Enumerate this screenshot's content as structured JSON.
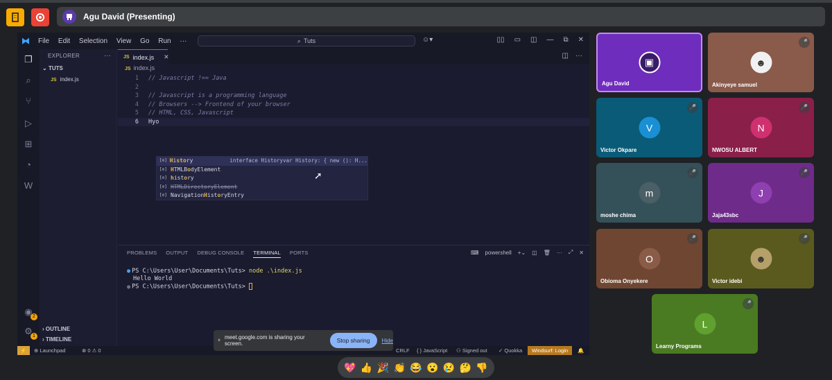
{
  "meet": {
    "presenting_title": "Agu David (Presenting)",
    "share_banner": {
      "message": "meet.google.com is sharing your screen.",
      "stop_label": "Stop sharing",
      "hide_label": "Hide"
    },
    "reactions": [
      "💖",
      "👍",
      "🎉",
      "👏",
      "😂",
      "😮",
      "😢",
      "🤔",
      "👎"
    ],
    "participants": [
      {
        "name": "Agu David",
        "avatar_letter": "",
        "muted": false,
        "color": "#6f2dbd",
        "highlight": true
      },
      {
        "name": "Akinyeye samuel",
        "avatar_letter": "",
        "muted": true,
        "color": "#8a5a4a"
      },
      {
        "name": "Victor Okpare",
        "avatar_letter": "V",
        "muted": true,
        "color": "#0a5b77",
        "avatar_color": "#1a8fd4"
      },
      {
        "name": "NWOSU ALBERT",
        "avatar_letter": "N",
        "muted": true,
        "color": "#8a1f4a",
        "avatar_color": "#d0306f"
      },
      {
        "name": "moshe chima",
        "avatar_letter": "m",
        "muted": true,
        "color": "#34515a",
        "avatar_color": "#4a5f66"
      },
      {
        "name": "Jaja43sbc",
        "avatar_letter": "J",
        "muted": true,
        "color": "#6f2b8a",
        "avatar_color": "#8e3fb0"
      },
      {
        "name": "Obioma Onyekere",
        "avatar_letter": "O",
        "muted": true,
        "color": "#6f4632",
        "avatar_color": "#8a5c47"
      },
      {
        "name": "Victor idebi",
        "avatar_letter": "",
        "muted": true,
        "color": "#5a5a1f"
      },
      {
        "name": "Learny Programs",
        "avatar_letter": "L",
        "muted": true,
        "color": "#4a7a22",
        "avatar_color": "#5fa02f"
      }
    ]
  },
  "vscode": {
    "menu": [
      "File",
      "Edit",
      "Selection",
      "View",
      "Go",
      "Run",
      "···"
    ],
    "search_text": "Tuts",
    "sidebar": {
      "title": "EXPLORER",
      "folder": "TUTS",
      "file": "index.js",
      "outline": "OUTLINE",
      "timeline": "TIMELINE"
    },
    "tab_label": "index.js",
    "breadcrumb": "index.js",
    "js_icon": "JS",
    "code_lines": [
      {
        "num": "1",
        "text": "// Javascript !== Java"
      },
      {
        "num": "2",
        "text": ""
      },
      {
        "num": "3",
        "text": "// Javascript is a programming language"
      },
      {
        "num": "4",
        "text": "// Browsers --> Frontend of your browser"
      },
      {
        "num": "5",
        "text": "// HTML, CSS, Javascript"
      },
      {
        "num": "6",
        "text": "Hyo"
      }
    ],
    "suggestions": [
      {
        "pre": "",
        "hl": "H",
        "mid": "i",
        "hl2": "sto",
        "post": "ry",
        "detail": "interface Historyvar History: { new (): H..."
      },
      {
        "pre": "",
        "hl": "H",
        "mid": "TMLB",
        "hl2": "o",
        "post": "dyElement",
        "detail": ""
      },
      {
        "pre": "",
        "hl": "h",
        "mid": "ist",
        "hl2": "o",
        "post": "ry",
        "detail": ""
      },
      {
        "pre": "",
        "hl": "",
        "mid": "HTMLDirectoryElement",
        "hl2": "",
        "post": "",
        "detail": "",
        "strike": true
      },
      {
        "pre": "Navigation",
        "hl": "H",
        "mid": "ist",
        "hl2": "o",
        "post": "ryEntry",
        "detail": ""
      }
    ],
    "panel_tabs": [
      "PROBLEMS",
      "OUTPUT",
      "DEBUG CONSOLE",
      "TERMINAL",
      "PORTS"
    ],
    "terminal_profile": "powershell",
    "terminal": {
      "prompt1": "PS C:\\Users\\User\\Documents\\Tuts>",
      "cmd1": "node .\\index.js",
      "output": "Hello World",
      "prompt2": "PS C:\\Users\\User\\Documents\\Tuts>"
    },
    "status": {
      "launchpad": "Launchpad",
      "problems": "⊗ 0 ⚠ 0",
      "crlf": "CRLF",
      "language": "JavaScript",
      "signed_out": "Signed out",
      "quokka": "Quokka",
      "windsurf": "Windsurf: Login"
    },
    "badges": {
      "accounts": "2",
      "settings": "1"
    }
  }
}
